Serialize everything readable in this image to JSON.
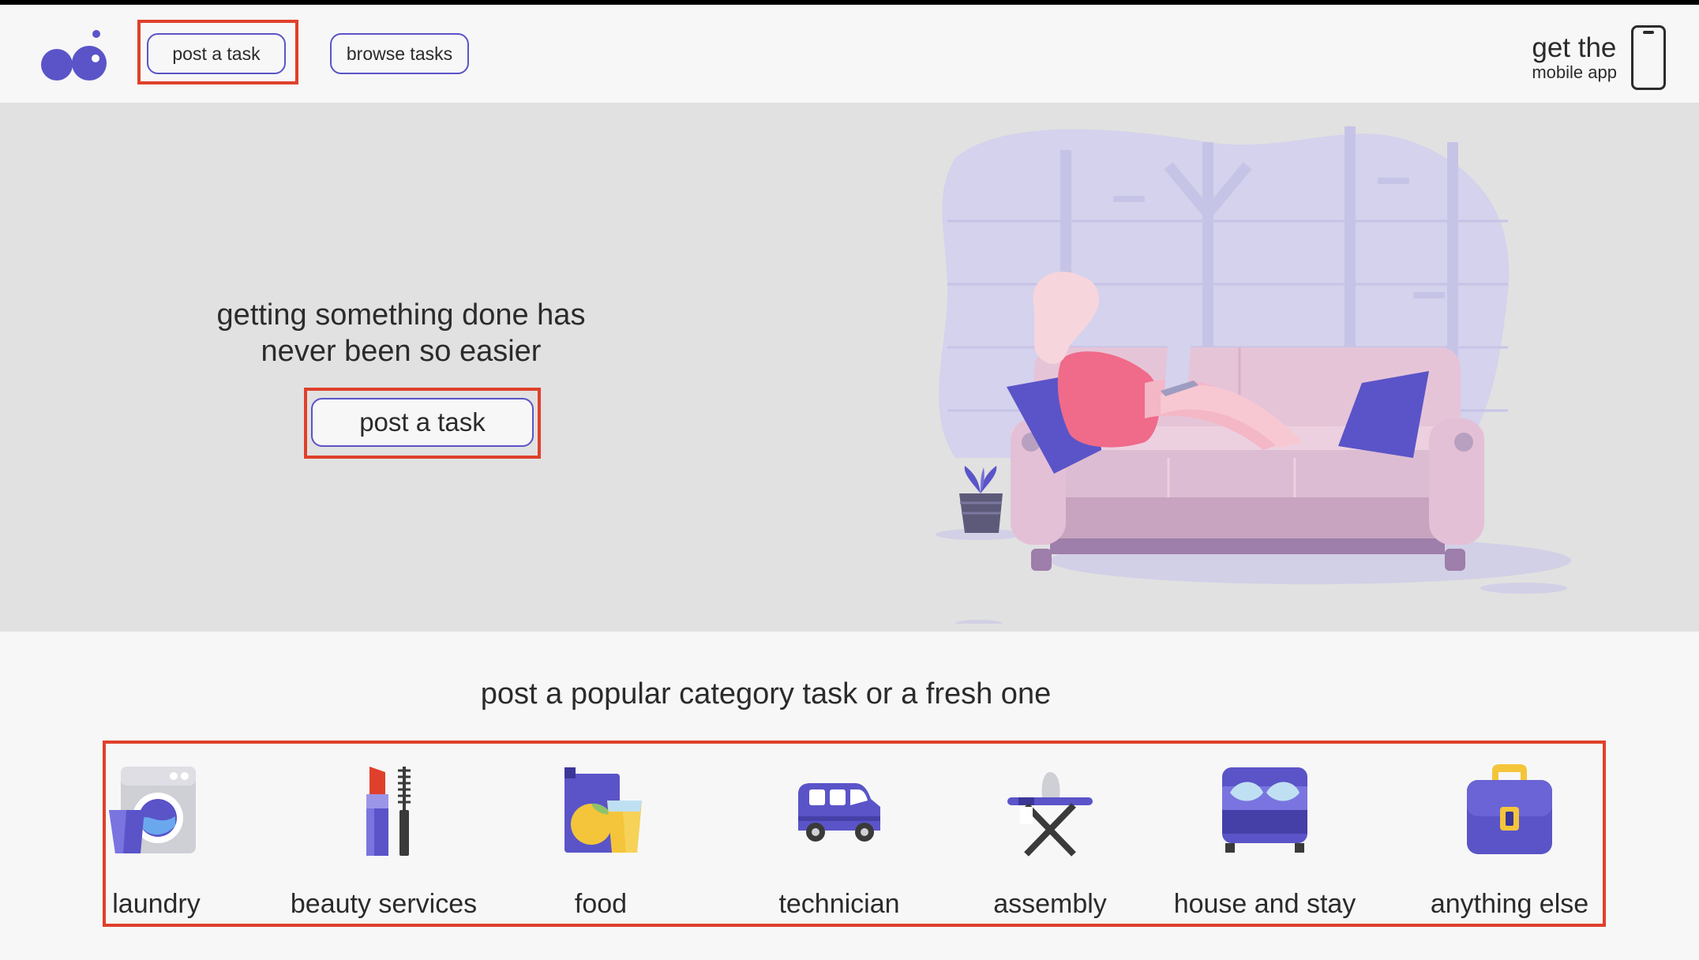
{
  "header": {
    "logo": "app-logo",
    "post_task_label": "post a task",
    "browse_tasks_label": "browse tasks",
    "app_promo_line1": "get the",
    "app_promo_line2": "mobile app"
  },
  "hero": {
    "title_line1": "getting something done has",
    "title_line2": "never been so easier",
    "cta_label": "post a task"
  },
  "categories": {
    "title": "post a popular category task or a fresh one",
    "items": [
      {
        "label": "laundry",
        "icon": "washing-machine-icon"
      },
      {
        "label": "beauty services",
        "icon": "lipstick-mascara-icon"
      },
      {
        "label": "food",
        "icon": "food-icon"
      },
      {
        "label": "technician",
        "icon": "van-icon"
      },
      {
        "label": "assembly",
        "icon": "ironing-board-icon"
      },
      {
        "label": "house and stay",
        "icon": "bed-icon"
      },
      {
        "label": "anything else",
        "icon": "briefcase-icon"
      }
    ]
  },
  "colors": {
    "accent": "#5a54c8",
    "highlight": "#e0402b",
    "hero_bg": "#e1e1e1",
    "page_bg": "#f7f7f7"
  }
}
